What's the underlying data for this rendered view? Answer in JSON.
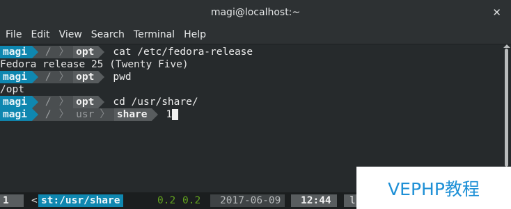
{
  "window": {
    "title": "magi@localhost:~",
    "close_glyph": "✕"
  },
  "menu": [
    "File",
    "Edit",
    "View",
    "Search",
    "Terminal",
    "Help"
  ],
  "prompt": {
    "user": "magi",
    "root": "/",
    "separator": "〉"
  },
  "lines": [
    {
      "kind": "prompt",
      "dirs": [
        "opt"
      ],
      "command": "cat /etc/fedora-release"
    },
    {
      "kind": "output",
      "text": "Fedora release 25 (Twenty Five)"
    },
    {
      "kind": "prompt",
      "dirs": [
        "opt"
      ],
      "command": "pwd"
    },
    {
      "kind": "output",
      "text": "/opt"
    },
    {
      "kind": "prompt",
      "dirs": [
        "opt"
      ],
      "command": "cd /usr/share/"
    },
    {
      "kind": "prompt",
      "dirs": [
        "usr",
        "share"
      ],
      "command": "1"
    }
  ],
  "status": {
    "window_index": "1",
    "left_marker": "<",
    "window_title": "st:/usr/share",
    "load": [
      "0.2",
      "0.2"
    ],
    "date": "2017-06-09",
    "time": "12:44",
    "host_fragment": "l"
  },
  "watermark": "VEPHP教程",
  "colors": {
    "prompt_user_bg": "#0f87b0",
    "prompt_path_bg": "#4a4e50",
    "terminal_bg": "#262a2c",
    "load_color": "#63a31f"
  }
}
